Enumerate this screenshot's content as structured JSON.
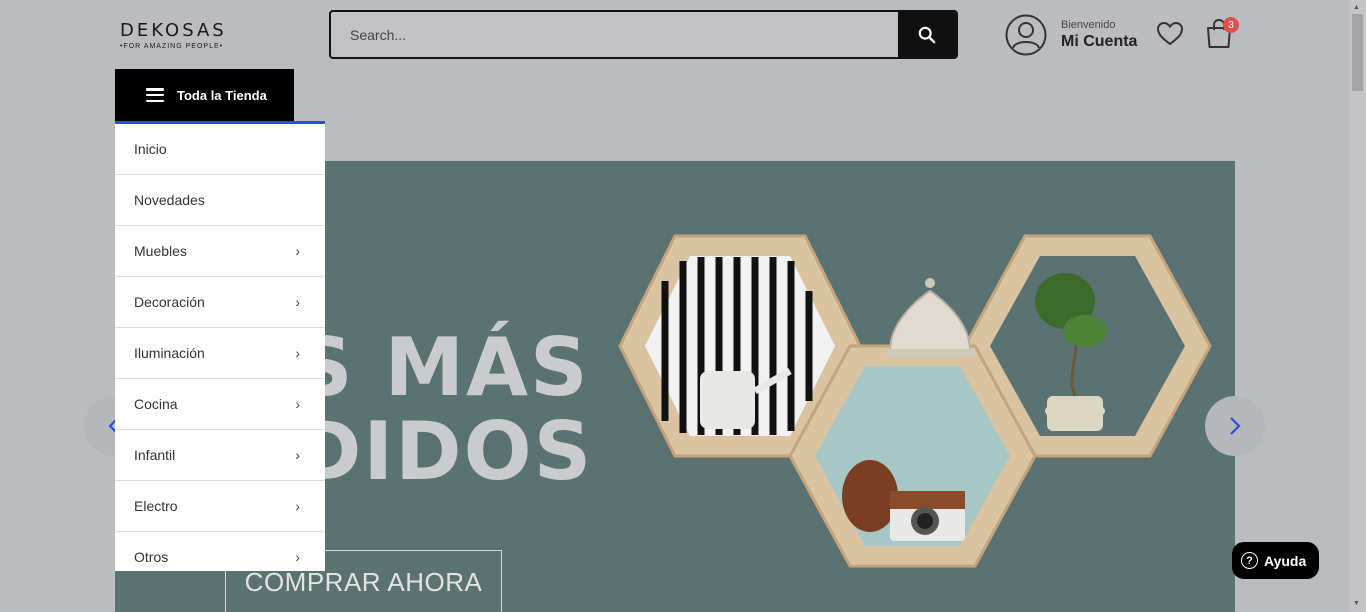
{
  "header": {
    "logo_main": "DEKOSAS",
    "logo_sub": "•FOR AMAZING PEOPLE•",
    "search_placeholder": "Search...",
    "account_welcome": "Bienvenido",
    "account_name": "Mi Cuenta",
    "cart_count": "3"
  },
  "store_menu": {
    "button_label": "Toda la Tienda",
    "items": [
      {
        "label": "Inicio",
        "has_submenu": false
      },
      {
        "label": "Novedades",
        "has_submenu": false
      },
      {
        "label": "Muebles",
        "has_submenu": true
      },
      {
        "label": "Decoración",
        "has_submenu": true
      },
      {
        "label": "Iluminación",
        "has_submenu": true
      },
      {
        "label": "Cocina",
        "has_submenu": true
      },
      {
        "label": "Infantil",
        "has_submenu": true
      },
      {
        "label": "Electro",
        "has_submenu": true
      },
      {
        "label": "Otros",
        "has_submenu": true
      }
    ]
  },
  "banner": {
    "line1": "S MÁS",
    "line2": "DIDOS",
    "cta": "COMPRAR AHORA"
  },
  "help": {
    "label": "Ayuda"
  },
  "icons": {
    "search": "search-icon",
    "account": "user-circle-icon",
    "wishlist": "heart-icon",
    "cart": "shopping-bag-icon",
    "menu": "hamburger-icon",
    "prev": "chevron-left-icon",
    "next": "chevron-right-icon",
    "help": "question-circle-icon"
  },
  "colors": {
    "accent": "#2a4fd6",
    "banner_bg": "#5b7272",
    "badge": "#d9534f"
  }
}
